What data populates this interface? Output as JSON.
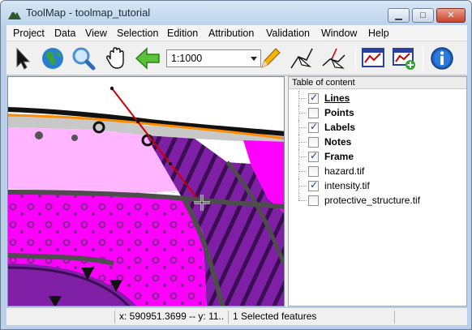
{
  "window": {
    "title": "ToolMap - toolmap_tutorial",
    "minimize": "▁",
    "maximize": "□",
    "close": "✕"
  },
  "menubar": [
    "Project",
    "Data",
    "View",
    "Selection",
    "Edition",
    "Attribution",
    "Validation",
    "Window",
    "Help"
  ],
  "toolbar": {
    "icons": [
      "select-arrow-icon",
      "globe-icon",
      "zoom-magnifier-icon",
      "pan-hand-icon",
      "back-arrow-icon",
      "draw-pencil-icon",
      "edit-vertex-icon",
      "modify-line-icon",
      "layer-table-icon",
      "add-layer-icon",
      "info-icon"
    ],
    "scale_value": "1:1000"
  },
  "toc": {
    "header": "Table of content",
    "items": [
      {
        "label": "Lines",
        "checked": true,
        "bold": true,
        "underline": true
      },
      {
        "label": "Points",
        "checked": false,
        "bold": true
      },
      {
        "label": "Labels",
        "checked": true,
        "bold": true
      },
      {
        "label": "Notes",
        "checked": false,
        "bold": true
      },
      {
        "label": "Frame",
        "checked": true,
        "bold": true
      },
      {
        "label": "hazard.tif",
        "checked": false,
        "bold": false
      },
      {
        "label": "intensity.tif",
        "checked": true,
        "bold": false
      },
      {
        "label": "protective_structure.tif",
        "checked": false,
        "bold": false
      }
    ]
  },
  "status": {
    "coords": "x: 590951.3699 -- y: 11...",
    "selection": "1 Selected features"
  },
  "colors": {
    "magenta": "#ff00ff",
    "purple": "#7f1fa5",
    "pink": "#ffb6ff",
    "orange": "#ff8c00",
    "red_line": "#cc0000"
  }
}
